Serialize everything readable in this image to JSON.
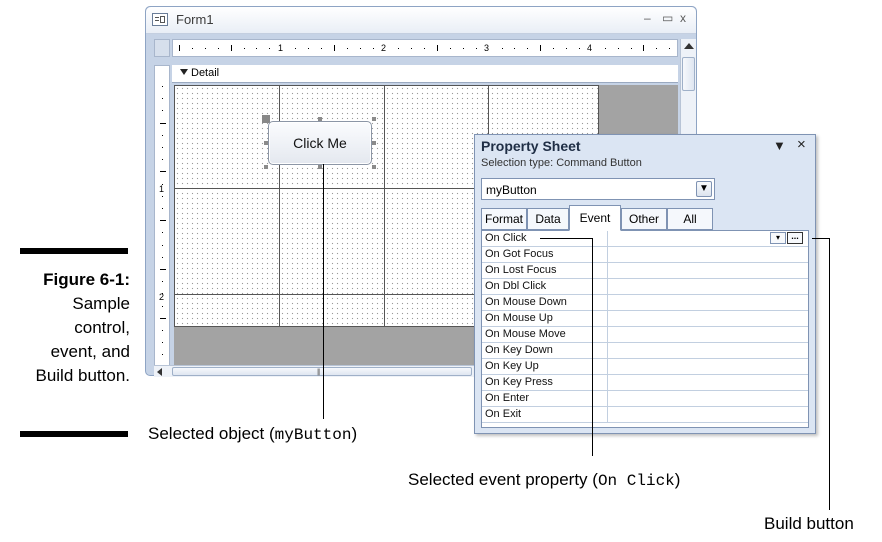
{
  "caption": {
    "figure": "Figure 6-1:",
    "lines": [
      "Sample",
      "control,",
      "event, and",
      "Build button."
    ]
  },
  "window": {
    "title": "Form1",
    "minimize": "–",
    "restore": "▭",
    "close": "x",
    "section": "Detail",
    "ruler_numbers": [
      "1",
      "2",
      "3",
      "4"
    ],
    "vruler_numbers": [
      "1",
      "2"
    ],
    "button_label": "Click Me"
  },
  "property_sheet": {
    "title": "Property Sheet",
    "menu_glyph": "▼",
    "close_glyph": "×",
    "selection_type": "Selection type:  Command Button",
    "selected_object": "myButton",
    "tabs": [
      "Format",
      "Data",
      "Event",
      "Other",
      "All"
    ],
    "active_tab": "Event",
    "properties": [
      "On Click",
      "On Got Focus",
      "On Lost Focus",
      "On Dbl Click",
      "On Mouse Down",
      "On Mouse Up",
      "On Mouse Move",
      "On Key Down",
      "On Key Up",
      "On Key Press",
      "On Enter",
      "On Exit"
    ],
    "dropdown_glyph": "▾",
    "build_glyph": "..."
  },
  "callouts": {
    "selected_object_prefix": "Selected object (",
    "selected_object_code": "myButton",
    "selected_object_suffix": ")",
    "selected_event_prefix": "Selected event property (",
    "selected_event_code": "On Click",
    "selected_event_suffix": ")",
    "build_button": "Build button"
  }
}
